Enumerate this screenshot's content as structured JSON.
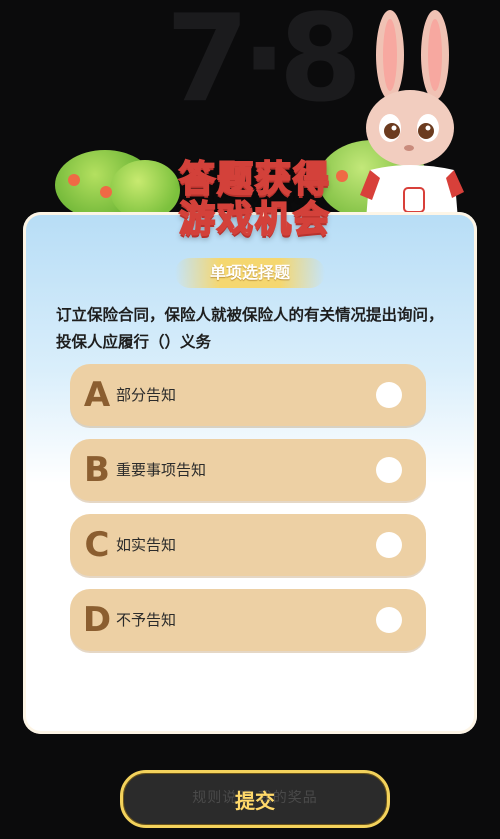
{
  "background": {
    "digits": "7·8"
  },
  "title": {
    "line1": "答题获得",
    "line2": "游戏机会"
  },
  "question": {
    "type_label": "单项选择题",
    "text": "订立保险合同，保险人就被保险人的有关情况提出询问，投保人应履行（）义务"
  },
  "options": [
    {
      "letter": "A",
      "text": "部分告知"
    },
    {
      "letter": "B",
      "text": "重要事项告知"
    },
    {
      "letter": "C",
      "text": "如实告知"
    },
    {
      "letter": "D",
      "text": "不予告知"
    }
  ],
  "submit": {
    "label": "提交",
    "ghost_text": "规则说明        我的奖品"
  },
  "colors": {
    "option_bg": "#edd0a4",
    "letter": "#8b5e30",
    "submit_border": "#f3d25c",
    "title_stroke": "#d3413a"
  }
}
